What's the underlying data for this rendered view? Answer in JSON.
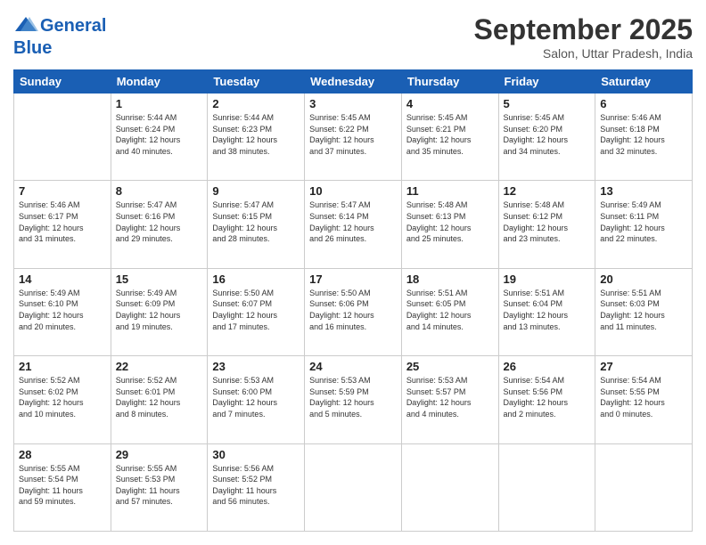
{
  "header": {
    "logo_line1": "General",
    "logo_line2": "Blue",
    "month": "September 2025",
    "location": "Salon, Uttar Pradesh, India"
  },
  "weekdays": [
    "Sunday",
    "Monday",
    "Tuesday",
    "Wednesday",
    "Thursday",
    "Friday",
    "Saturday"
  ],
  "weeks": [
    [
      {
        "day": "",
        "detail": ""
      },
      {
        "day": "1",
        "detail": "Sunrise: 5:44 AM\nSunset: 6:24 PM\nDaylight: 12 hours\nand 40 minutes."
      },
      {
        "day": "2",
        "detail": "Sunrise: 5:44 AM\nSunset: 6:23 PM\nDaylight: 12 hours\nand 38 minutes."
      },
      {
        "day": "3",
        "detail": "Sunrise: 5:45 AM\nSunset: 6:22 PM\nDaylight: 12 hours\nand 37 minutes."
      },
      {
        "day": "4",
        "detail": "Sunrise: 5:45 AM\nSunset: 6:21 PM\nDaylight: 12 hours\nand 35 minutes."
      },
      {
        "day": "5",
        "detail": "Sunrise: 5:45 AM\nSunset: 6:20 PM\nDaylight: 12 hours\nand 34 minutes."
      },
      {
        "day": "6",
        "detail": "Sunrise: 5:46 AM\nSunset: 6:18 PM\nDaylight: 12 hours\nand 32 minutes."
      }
    ],
    [
      {
        "day": "7",
        "detail": "Sunrise: 5:46 AM\nSunset: 6:17 PM\nDaylight: 12 hours\nand 31 minutes."
      },
      {
        "day": "8",
        "detail": "Sunrise: 5:47 AM\nSunset: 6:16 PM\nDaylight: 12 hours\nand 29 minutes."
      },
      {
        "day": "9",
        "detail": "Sunrise: 5:47 AM\nSunset: 6:15 PM\nDaylight: 12 hours\nand 28 minutes."
      },
      {
        "day": "10",
        "detail": "Sunrise: 5:47 AM\nSunset: 6:14 PM\nDaylight: 12 hours\nand 26 minutes."
      },
      {
        "day": "11",
        "detail": "Sunrise: 5:48 AM\nSunset: 6:13 PM\nDaylight: 12 hours\nand 25 minutes."
      },
      {
        "day": "12",
        "detail": "Sunrise: 5:48 AM\nSunset: 6:12 PM\nDaylight: 12 hours\nand 23 minutes."
      },
      {
        "day": "13",
        "detail": "Sunrise: 5:49 AM\nSunset: 6:11 PM\nDaylight: 12 hours\nand 22 minutes."
      }
    ],
    [
      {
        "day": "14",
        "detail": "Sunrise: 5:49 AM\nSunset: 6:10 PM\nDaylight: 12 hours\nand 20 minutes."
      },
      {
        "day": "15",
        "detail": "Sunrise: 5:49 AM\nSunset: 6:09 PM\nDaylight: 12 hours\nand 19 minutes."
      },
      {
        "day": "16",
        "detail": "Sunrise: 5:50 AM\nSunset: 6:07 PM\nDaylight: 12 hours\nand 17 minutes."
      },
      {
        "day": "17",
        "detail": "Sunrise: 5:50 AM\nSunset: 6:06 PM\nDaylight: 12 hours\nand 16 minutes."
      },
      {
        "day": "18",
        "detail": "Sunrise: 5:51 AM\nSunset: 6:05 PM\nDaylight: 12 hours\nand 14 minutes."
      },
      {
        "day": "19",
        "detail": "Sunrise: 5:51 AM\nSunset: 6:04 PM\nDaylight: 12 hours\nand 13 minutes."
      },
      {
        "day": "20",
        "detail": "Sunrise: 5:51 AM\nSunset: 6:03 PM\nDaylight: 12 hours\nand 11 minutes."
      }
    ],
    [
      {
        "day": "21",
        "detail": "Sunrise: 5:52 AM\nSunset: 6:02 PM\nDaylight: 12 hours\nand 10 minutes."
      },
      {
        "day": "22",
        "detail": "Sunrise: 5:52 AM\nSunset: 6:01 PM\nDaylight: 12 hours\nand 8 minutes."
      },
      {
        "day": "23",
        "detail": "Sunrise: 5:53 AM\nSunset: 6:00 PM\nDaylight: 12 hours\nand 7 minutes."
      },
      {
        "day": "24",
        "detail": "Sunrise: 5:53 AM\nSunset: 5:59 PM\nDaylight: 12 hours\nand 5 minutes."
      },
      {
        "day": "25",
        "detail": "Sunrise: 5:53 AM\nSunset: 5:57 PM\nDaylight: 12 hours\nand 4 minutes."
      },
      {
        "day": "26",
        "detail": "Sunrise: 5:54 AM\nSunset: 5:56 PM\nDaylight: 12 hours\nand 2 minutes."
      },
      {
        "day": "27",
        "detail": "Sunrise: 5:54 AM\nSunset: 5:55 PM\nDaylight: 12 hours\nand 0 minutes."
      }
    ],
    [
      {
        "day": "28",
        "detail": "Sunrise: 5:55 AM\nSunset: 5:54 PM\nDaylight: 11 hours\nand 59 minutes."
      },
      {
        "day": "29",
        "detail": "Sunrise: 5:55 AM\nSunset: 5:53 PM\nDaylight: 11 hours\nand 57 minutes."
      },
      {
        "day": "30",
        "detail": "Sunrise: 5:56 AM\nSunset: 5:52 PM\nDaylight: 11 hours\nand 56 minutes."
      },
      {
        "day": "",
        "detail": ""
      },
      {
        "day": "",
        "detail": ""
      },
      {
        "day": "",
        "detail": ""
      },
      {
        "day": "",
        "detail": ""
      }
    ]
  ]
}
